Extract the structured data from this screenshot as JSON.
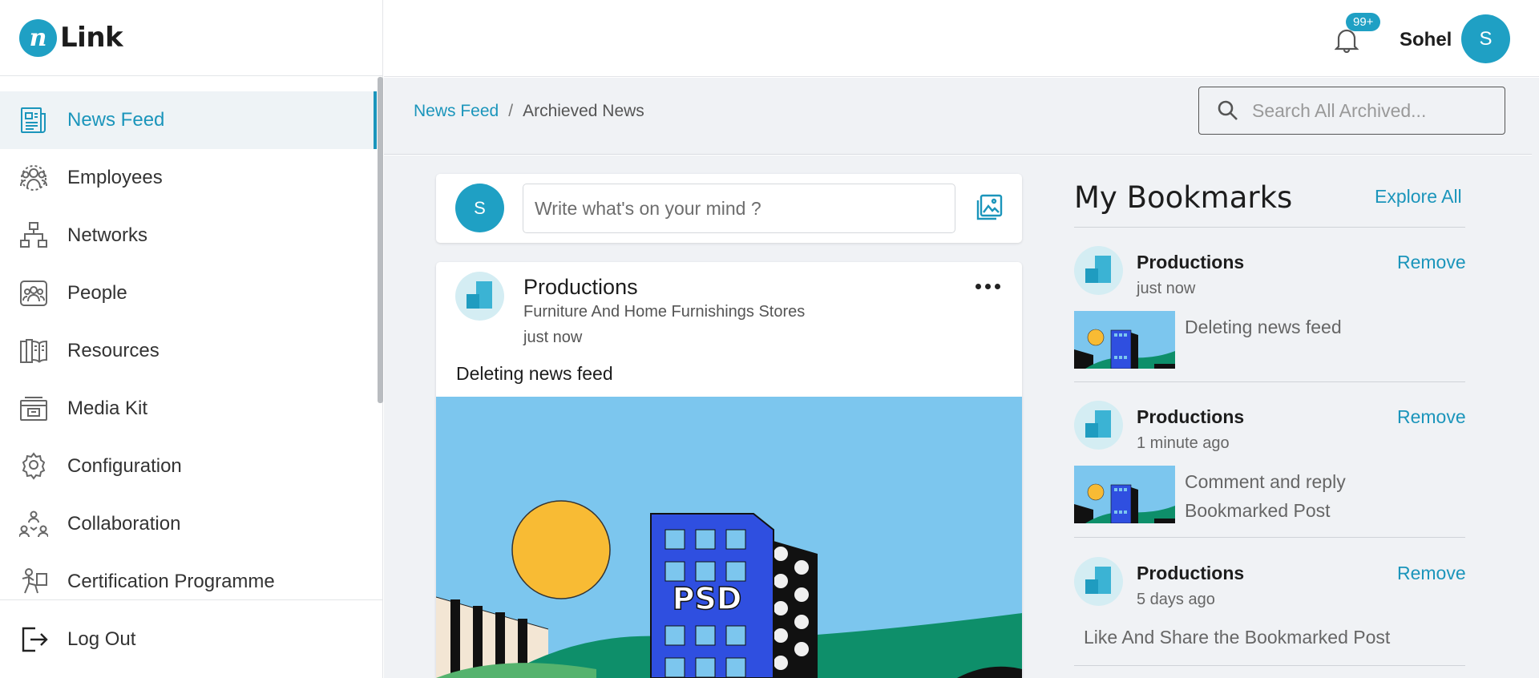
{
  "app": {
    "logo_text": "Link",
    "logo_mark": "n"
  },
  "sidebar": {
    "items": [
      {
        "label": "News Feed",
        "icon": "newspaper-icon",
        "active": true
      },
      {
        "label": "Employees",
        "icon": "employees-icon"
      },
      {
        "label": "Networks",
        "icon": "network-icon"
      },
      {
        "label": "People",
        "icon": "people-icon"
      },
      {
        "label": "Resources",
        "icon": "book-icon"
      },
      {
        "label": "Media Kit",
        "icon": "media-kit-icon"
      },
      {
        "label": "Configuration",
        "icon": "gear-icon"
      },
      {
        "label": "Collaboration",
        "icon": "collaboration-icon"
      },
      {
        "label": "Certification Programme",
        "icon": "certification-icon"
      }
    ],
    "logout_label": "Log Out"
  },
  "header": {
    "notification_badge": "99+",
    "user_name": "Sohel",
    "user_initial": "S"
  },
  "breadcrumb": {
    "root": "News Feed",
    "separator": "/",
    "current": "Archieved News"
  },
  "search": {
    "placeholder": "Search All Archived..."
  },
  "composer": {
    "avatar_initial": "S",
    "placeholder": "Write what's on your mind ?"
  },
  "post": {
    "org_name": "Productions",
    "org_subtitle": "Furniture And Home Furnishings Stores",
    "time": "just now",
    "text": "Deleting news feed",
    "image_label": "PSD"
  },
  "bookmarks": {
    "title": "My Bookmarks",
    "explore_label": "Explore All",
    "items": [
      {
        "name": "Productions",
        "time": "just now",
        "remove_label": "Remove",
        "text": "Deleting news feed",
        "has_thumb": true
      },
      {
        "name": "Productions",
        "time": "1 minute ago",
        "remove_label": "Remove",
        "text_line1": "Comment and reply",
        "text_line2": "Bookmarked Post",
        "has_thumb": true
      },
      {
        "name": "Productions",
        "time": "5 days ago",
        "remove_label": "Remove",
        "text": "Like And Share the Bookmarked Post",
        "has_thumb": false
      }
    ]
  },
  "colors": {
    "accent": "#1fa0c4",
    "link": "#1b95bb",
    "page_bg": "#f0f2f5",
    "sky": "#7cc6ee",
    "building": "#2f4fe0",
    "sun": "#f8bb34",
    "hill": "#0e8f6a"
  }
}
